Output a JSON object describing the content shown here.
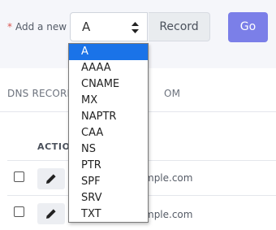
{
  "add_form": {
    "required_mark": "*",
    "label": "Add a new",
    "selected_type": "A",
    "addon_label": "Record",
    "go_label": "Go"
  },
  "section": {
    "title_left": "DNS RECORD",
    "title_right": "OM"
  },
  "table": {
    "action_header": "ACTIO",
    "rows": [
      {
        "name_fragment": "mple.com"
      },
      {
        "name_fragment": "mple.com"
      }
    ]
  },
  "dropdown": {
    "options": [
      "A",
      "AAAA",
      "CNAME",
      "MX",
      "NAPTR",
      "CAA",
      "NS",
      "PTR",
      "SPF",
      "SRV",
      "TXT"
    ],
    "selected": "A"
  },
  "colors": {
    "accent": "#7b7fe8",
    "selected_option": "#1a73e8",
    "required": "#d9534f"
  },
  "icons": [
    "sort-arrows-icon",
    "pencil-icon"
  ]
}
